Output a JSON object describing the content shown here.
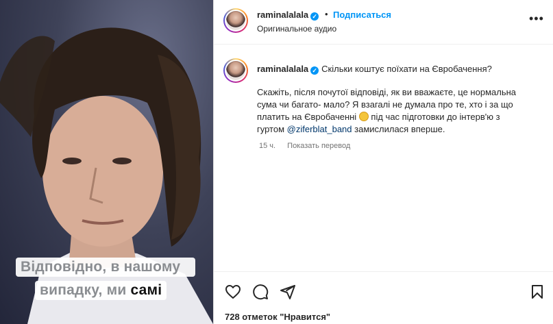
{
  "media": {
    "caption_line1": "Відповідно, в нашому",
    "caption_line2_a": "випадку, ми ",
    "caption_line2_b": "самі"
  },
  "header": {
    "username": "raminalalala",
    "separator": "•",
    "follow_label": "Подписаться",
    "audio_label": "Оригинальное аудио",
    "more_label": "•••"
  },
  "comment": {
    "username": "raminalalala",
    "title": "Скільки коштує поїхати на Євробачення?",
    "text_part1": "Скажіть, після почутої відповіді, як ви вважаєте, це нормальна сума чи багато- мало? Я взагалі не думала про те, хто і за що платить на Євробаченні ",
    "text_part2": " під час підготовки до інтерв'ю з гуртом ",
    "mention": "@ziferblat_band",
    "text_part3": " замислилася вперше.",
    "time": "15 ч.",
    "translate_label": "Показать перевод"
  },
  "actions": {
    "likes_text": "728 отметок \"Нравится\""
  },
  "colors": {
    "accent": "#0095f6",
    "mention": "#00376b",
    "verified": "#0095f6"
  }
}
